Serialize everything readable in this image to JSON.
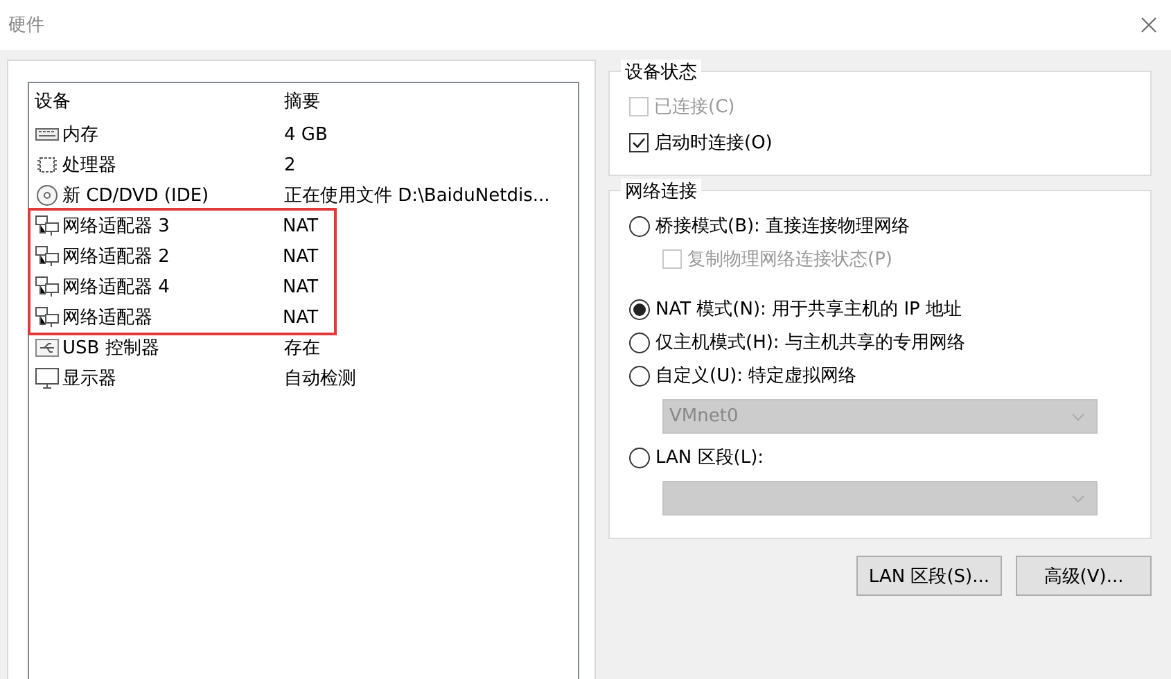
{
  "window": {
    "title": "硬件"
  },
  "devices": {
    "columns": [
      "设备",
      "摘要"
    ],
    "rows": [
      {
        "kind": "memory",
        "name": "内存",
        "summary": "4 GB",
        "highlighted": false
      },
      {
        "kind": "cpu",
        "name": "处理器",
        "summary": "2",
        "highlighted": false
      },
      {
        "kind": "cd",
        "name": "新 CD/DVD (IDE)",
        "summary": "正在使用文件 D:\\BaiduNetdis...",
        "highlighted": false
      },
      {
        "kind": "network",
        "name": "网络适配器 3",
        "summary": "NAT",
        "highlighted": true
      },
      {
        "kind": "network",
        "name": "网络适配器 2",
        "summary": "NAT",
        "highlighted": true
      },
      {
        "kind": "network",
        "name": "网络适配器 4",
        "summary": "NAT",
        "highlighted": true
      },
      {
        "kind": "network",
        "name": "网络适配器",
        "summary": "NAT",
        "highlighted": true
      },
      {
        "kind": "usb",
        "name": "USB 控制器",
        "summary": "存在",
        "highlighted": false
      },
      {
        "kind": "monitor",
        "name": "显示器",
        "summary": "自动检测",
        "highlighted": false
      }
    ]
  },
  "device_status": {
    "title": "设备状态",
    "options": [
      {
        "label": "已连接(C)",
        "checked": false,
        "disabled": true
      },
      {
        "label": "启动时连接(O)",
        "checked": true,
        "disabled": false
      }
    ]
  },
  "network_connection": {
    "title": "网络连接",
    "items": [
      {
        "kind": "radio",
        "label": "桥接模式(B): 直接连接物理网络",
        "selected": false
      },
      {
        "kind": "checkbox",
        "label": "复制物理网络连接状态(P)",
        "checked": false,
        "disabled": true
      },
      {
        "kind": "radio",
        "label": "NAT 模式(N): 用于共享主机的 IP 地址",
        "selected": true
      },
      {
        "kind": "radio",
        "label": "仅主机模式(H): 与主机共享的专用网络",
        "selected": false
      },
      {
        "kind": "radio",
        "label": "自定义(U): 特定虚拟网络",
        "selected": false
      },
      {
        "kind": "dropdown",
        "value": "VMnet0",
        "disabled": true
      },
      {
        "kind": "radio",
        "label": "LAN 区段(L):",
        "selected": false
      },
      {
        "kind": "dropdown",
        "disabled": true
      }
    ]
  },
  "buttons": [
    "LAN 区段(S)...",
    "高级(V)..."
  ]
}
